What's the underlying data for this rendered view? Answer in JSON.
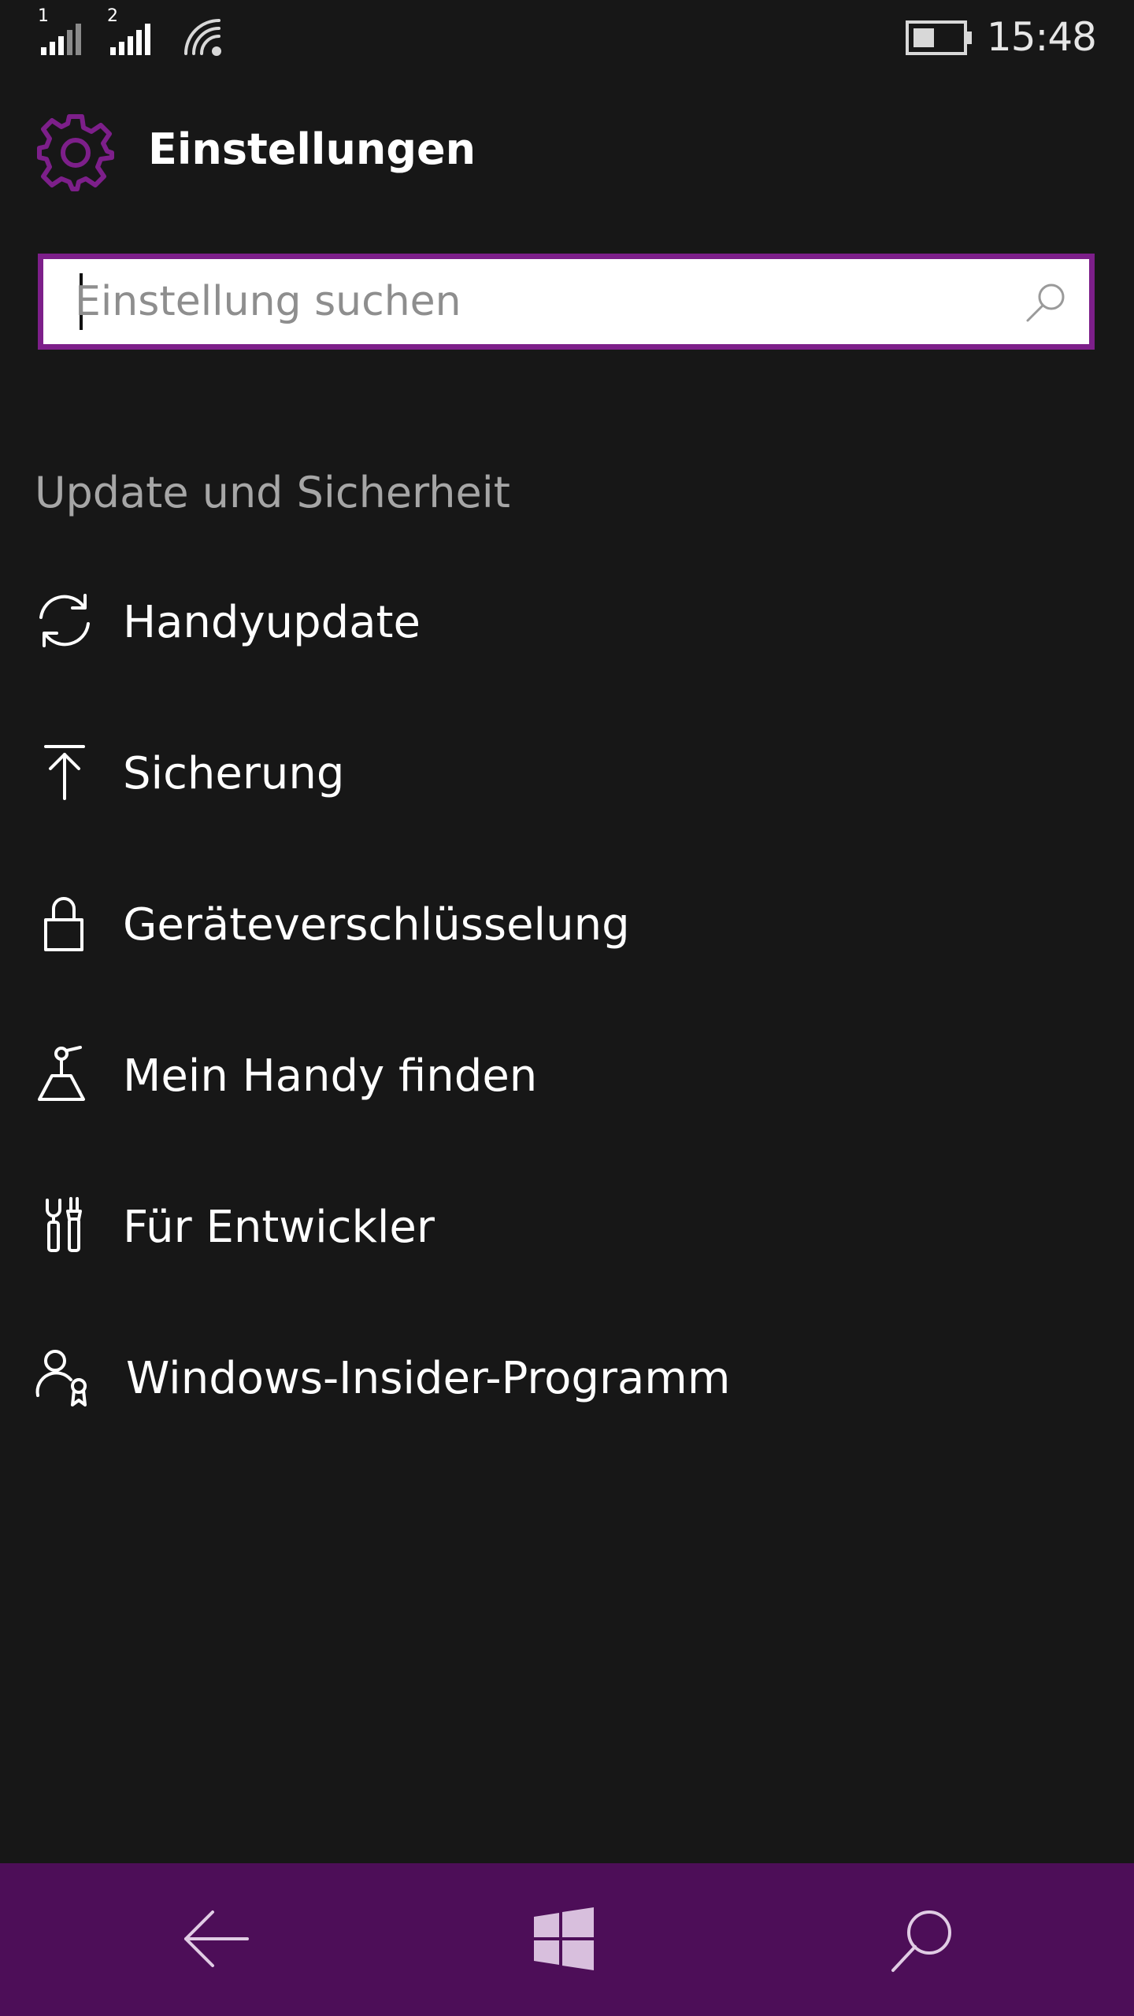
{
  "status_bar": {
    "sim1_label": "1",
    "sim2_label": "2",
    "time": "15:48",
    "icons": [
      "signal-strength-icon",
      "signal-strength-icon",
      "wifi-icon",
      "battery-icon"
    ]
  },
  "header": {
    "title": "Einstellungen",
    "icon": "gear-icon"
  },
  "search": {
    "placeholder": "Einstellung suchen",
    "value": "",
    "icon": "search-icon"
  },
  "section": {
    "title": "Update und Sicherheit"
  },
  "menu": {
    "items": [
      {
        "label": "Handyupdate",
        "icon": "sync-icon"
      },
      {
        "label": "Sicherung",
        "icon": "upload-icon"
      },
      {
        "label": "Geräteverschlüsselung",
        "icon": "lock-icon"
      },
      {
        "label": "Mein Handy finden",
        "icon": "find-phone-icon"
      },
      {
        "label": "Für Entwickler",
        "icon": "developer-tools-icon"
      },
      {
        "label": "Windows-Insider-Programm",
        "icon": "insider-icon"
      }
    ]
  },
  "nav_bar": {
    "buttons": [
      "back-arrow-icon",
      "windows-logo-icon",
      "search-icon"
    ]
  },
  "colors": {
    "background": "#171717",
    "accent": "#7d1f8a",
    "nav_bar": "#4d0e58",
    "text": "#ffffff",
    "section_text": "#a6a6a6"
  }
}
